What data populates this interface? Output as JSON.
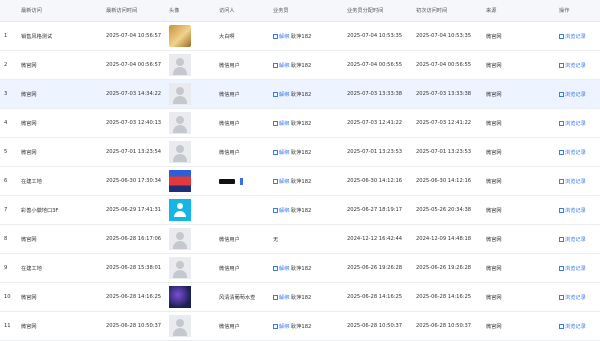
{
  "headers": [
    "",
    "最新访问",
    "最新访问时间",
    "头像",
    "访问人",
    "业务员",
    "业务员分配时间",
    "初次访问时间",
    "来源",
    "操作"
  ],
  "unbind_label": "解绑",
  "view_label": "浏览记录",
  "rows": [
    {
      "idx": "1",
      "latest": "销售风格测试",
      "latest_time": "2025-07-04 10:56:57",
      "avatar": "dog",
      "visitor": "大白啊",
      "salesman": "耿萍182",
      "has_unbind": true,
      "assign_time": "2025-07-04 10:53:35",
      "first_time": "2025-07-04 10:53:35",
      "source": "微官网"
    },
    {
      "idx": "2",
      "latest": "微官网",
      "latest_time": "2025-07-04 00:56:57",
      "avatar": "default",
      "visitor": "微信用户",
      "salesman": "耿萍182",
      "has_unbind": true,
      "assign_time": "2025-07-04 00:56:55",
      "first_time": "2025-07-04 00:56:55",
      "source": "微官网"
    },
    {
      "idx": "3",
      "latest": "微官网",
      "latest_time": "2025-07-03 14:34:22",
      "avatar": "default",
      "visitor": "微信用户",
      "salesman": "耿萍182",
      "has_unbind": true,
      "assign_time": "2025-07-03 13:33:38",
      "first_time": "2025-07-03 13:33:38",
      "source": "微官网",
      "highlight": true
    },
    {
      "idx": "4",
      "latest": "微官网",
      "latest_time": "2025-07-03 12:40:13",
      "avatar": "default",
      "visitor": "微信用户",
      "salesman": "耿萍182",
      "has_unbind": true,
      "assign_time": "2025-07-03 12:41:22",
      "first_time": "2025-07-03 12:41:22",
      "source": "微官网"
    },
    {
      "idx": "5",
      "latest": "微官网",
      "latest_time": "2025-07-01 13:23:54",
      "avatar": "default",
      "visitor": "微信用户",
      "salesman": "耿萍182",
      "has_unbind": true,
      "assign_time": "2025-07-01 13:23:53",
      "first_time": "2025-07-01 13:23:53",
      "source": "微官网"
    },
    {
      "idx": "6",
      "latest": "在建工地",
      "latest_time": "2025-06-30 17:30:34",
      "avatar": "red",
      "visitor": "",
      "redacted": true,
      "salesman": "耿萍182",
      "has_unbind": true,
      "assign_time": "2025-06-30 14:12:16",
      "first_time": "2025-06-30 14:12:16",
      "source": "微官网"
    },
    {
      "idx": "7",
      "latest": "彩善小徽地口3F",
      "latest_time": "2025-06-29 17:41:31",
      "avatar": "cyan",
      "visitor": "",
      "salesman": "耿萍182",
      "has_unbind": true,
      "assign_time": "2025-06-27 18:19:17",
      "first_time": "2025-05-26 20:34:38",
      "source": "微官网"
    },
    {
      "idx": "8",
      "latest": "微官网",
      "latest_time": "2025-06-28 16:17:06",
      "avatar": "default",
      "visitor": "微信用户",
      "salesman": "无",
      "has_unbind": false,
      "assign_time": "2024-12-12 16:42:44",
      "first_time": "2024-12-09 14:48:18",
      "source": "微官网"
    },
    {
      "idx": "9",
      "latest": "在建工地",
      "latest_time": "2025-06-28 15:38:01",
      "avatar": "default",
      "visitor": "微信用户",
      "salesman": "耿萍182",
      "has_unbind": true,
      "assign_time": "2025-06-26 19:26:28",
      "first_time": "2025-06-26 19:26:28",
      "source": "微官网"
    },
    {
      "idx": "10",
      "latest": "微官网",
      "latest_time": "2025-06-28 14:16:25",
      "avatar": "night",
      "visitor": "风清清葡萄水查",
      "salesman": "耿萍182",
      "has_unbind": true,
      "assign_time": "2025-06-28 14:16:25",
      "first_time": "2025-06-28 14:16:25",
      "source": "微官网"
    },
    {
      "idx": "11",
      "latest": "微官网",
      "latest_time": "2025-06-28 10:50:37",
      "avatar": "default",
      "visitor": "微信用户",
      "salesman": "耿萍182",
      "has_unbind": true,
      "assign_time": "2025-06-28 10:50:37",
      "first_time": "2025-06-28 10:50:37",
      "source": "微官网"
    }
  ]
}
